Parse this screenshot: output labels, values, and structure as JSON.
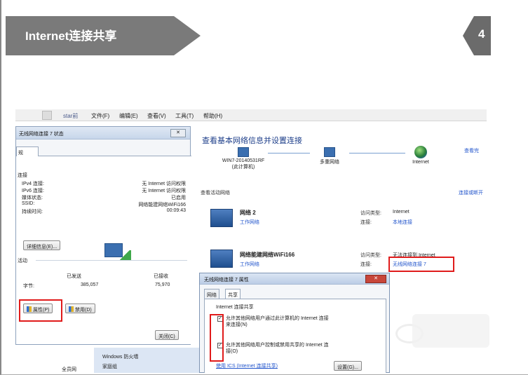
{
  "slide": {
    "title": "Internet连接共享",
    "page_number": "4"
  },
  "network_center": {
    "user_label": "star前",
    "menu": [
      "文件(F)",
      "编辑(E)",
      "查看(V)",
      "工具(T)",
      "帮助(H)"
    ],
    "heading": "查看基本网络信息并设置连接",
    "view_full_map": "查看完",
    "map_nodes": {
      "computer_line1": "WIN7-20140531RF",
      "computer_line2": "(此计算机)",
      "network": "多重网络",
      "internet": "Internet"
    },
    "active_networks_label": "查看活动网络",
    "connect_disconnect": "连接或断开",
    "networks": [
      {
        "name": "网络 2",
        "type": "工作网络",
        "access_label": "访问类型:",
        "access_value": "Internet",
        "conn_label": "连接:",
        "conn_value": "本地连接"
      },
      {
        "name": "网络能建网络WiFi166",
        "type": "工作网络",
        "access_label": "访问类型:",
        "access_value": "无法连接到 Internet",
        "conn_label": "连接:",
        "conn_value": "无线网络连接 7"
      }
    ],
    "bottom_items": [
      "Windows 防火墙",
      "家庭组"
    ],
    "bottom_left_label": "全员网"
  },
  "status_dialog": {
    "title": "无线网络连接 7 状态",
    "tab": "规",
    "connection_group": "连接",
    "rows": [
      {
        "label": "IPv4 连接:",
        "value": "无 Internet 访问权限"
      },
      {
        "label": "IPv6 连接:",
        "value": "无 Internet 访问权限"
      },
      {
        "label": "媒体状态:",
        "value": "已启用"
      },
      {
        "label": "SSID:",
        "value": "网络能建网络WiFi166"
      },
      {
        "label": "持续时间:",
        "value": "00:09:43"
      }
    ],
    "details_button": "详细信息(E)...",
    "activity_group": "活动",
    "sent_label": "已发送",
    "received_label": "已接收",
    "bytes_label": "字节:",
    "bytes_sent": "385,057",
    "bytes_received": "75,970",
    "properties_button": "属性(P)",
    "disable_button": "禁用(D)",
    "close_button": "关闭(C)"
  },
  "properties_dialog": {
    "title": "无线网络连接 7 属性",
    "tabs": [
      "网络",
      "共享"
    ],
    "section": "Internet 连接共享",
    "checkbox1_line1": "允许其他网络用户通过此计算机的 Internet 连接",
    "checkbox1_line2": "来连接(N)",
    "checkbox2_line1": "允许其他网络用户控制或禁用共享的 Internet 连",
    "checkbox2_line2": "接(O)",
    "link": "使用 ICS (Internet 连接共享)",
    "settings_button": "设置(G)...",
    "checkbox1_checked": true,
    "checkbox2_checked": true
  },
  "colors": {
    "highlight": "#e01b1b",
    "banner": "#7a7a7a",
    "link": "#2255cc"
  }
}
